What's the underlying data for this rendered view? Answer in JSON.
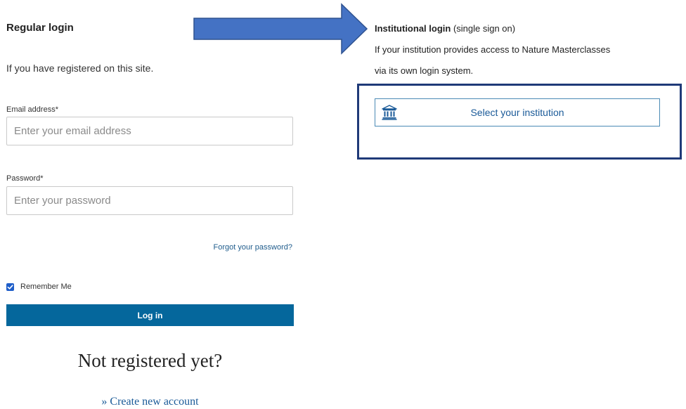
{
  "regular_login": {
    "title": "Regular login",
    "description": "If you have registered on this site.",
    "email": {
      "label": "Email address*",
      "placeholder": "Enter your email address",
      "value": ""
    },
    "password": {
      "label": "Password*",
      "placeholder": "Enter your password",
      "value": ""
    },
    "forgot_password": "Forgot your password?",
    "remember_me": {
      "label": "Remember Me",
      "checked": true
    },
    "login_button": "Log in",
    "not_registered": "Not registered yet?",
    "create_account": "» Create new account"
  },
  "institutional_login": {
    "title_bold": "Institutional login",
    "title_suffix": " (single sign on)",
    "description_line1": "If your institution provides access to Nature Masterclasses",
    "description_line2": "via its own login system.",
    "select_button": "Select your institution"
  },
  "icons": {
    "institution": "institution-building-icon",
    "checkmark": "check-icon",
    "arrow": "arrow-right-icon"
  },
  "colors": {
    "primary_button": "#05679c",
    "link": "#1a5a98",
    "arrow_fill": "#4472c4",
    "highlight_border": "#1f3a78",
    "checkbox": "#1f5ec9"
  }
}
